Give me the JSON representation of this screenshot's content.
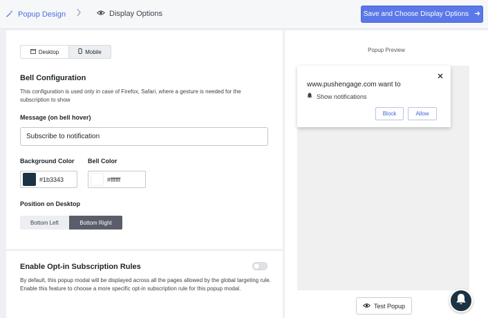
{
  "header": {
    "breadcrumb_1": "Popup Design",
    "breadcrumb_2": "Display Options",
    "save_label": "Save and Choose Display Options"
  },
  "device_toggle": {
    "desktop": "Desktop",
    "mobile": "Mobile",
    "selected": "Desktop"
  },
  "bell_config": {
    "title": "Bell Configuration",
    "description": "This configuration is used only in case of Firefox, Safari, where a gesture is needed for the subscription to show",
    "message_label": "Message (on bell hover)",
    "message_value": "Subscribe to notification",
    "bg_color_label": "Background Color",
    "bg_color_value": "#1b3343",
    "bell_color_label": "Bell Color",
    "bell_color_value": "#ffffff",
    "position_label": "Position on Desktop",
    "position_options": [
      "Bottom Left",
      "Bottom Right"
    ],
    "position_selected": "Bottom Right"
  },
  "opt_in": {
    "title": "Enable Opt-in Subscription Rules",
    "description": "By default, this popup modal will be displayed across all the pages allowed by the global targeting rule. Enable this feature to choose a more specific opt-in subscription rule for this popup modal.",
    "enabled": false
  },
  "preview": {
    "title": "Popup Preview",
    "site_text": "www.pushengage.com want to",
    "show_text": "Show notifications",
    "block_label": "Block",
    "allow_label": "Allow",
    "test_label": "Test Popup"
  },
  "colors": {
    "accent": "#5a78e8",
    "bell_bg": "#1b3343",
    "bell_fg": "#ffffff"
  }
}
